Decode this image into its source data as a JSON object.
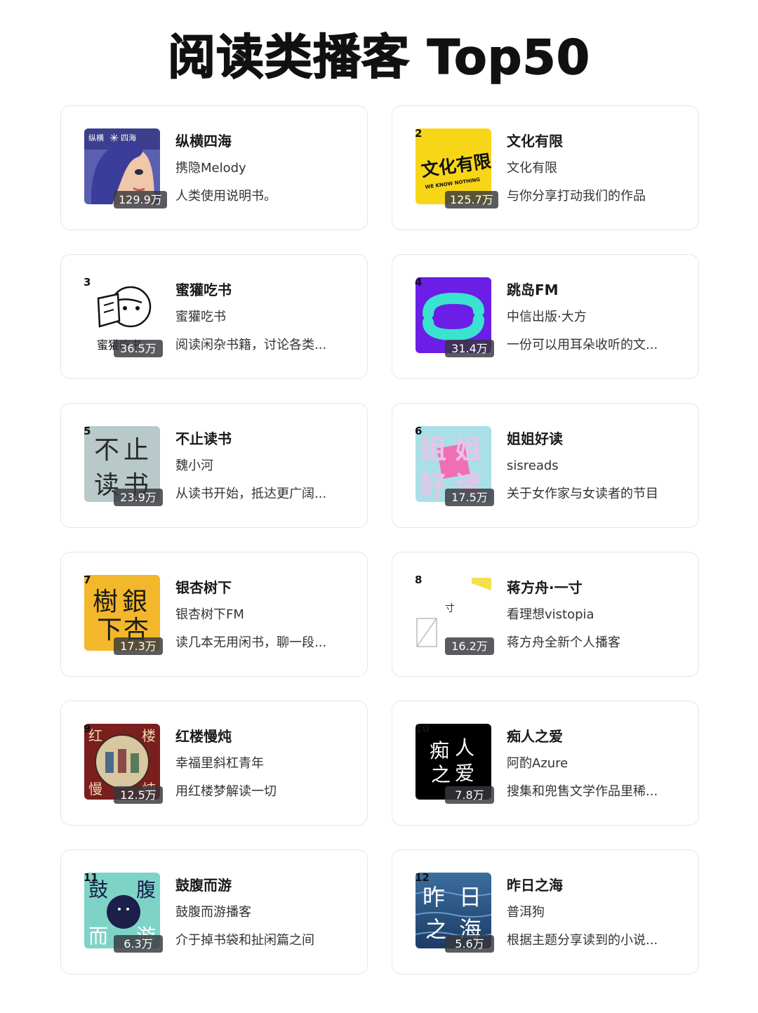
{
  "title": "阅读类播客 Top50",
  "podcasts": [
    {
      "rank": "",
      "name": "纵横四海",
      "author": "携隐Melody",
      "desc": "人类使用说明书。",
      "plays": "129.9万",
      "cover_text": [
        "纵横",
        "四海"
      ]
    },
    {
      "rank": "2",
      "name": "文化有限",
      "author": "文化有限",
      "desc": "与你分享打动我们的作品",
      "plays": "125.7万",
      "cover_text": [
        "文化有限",
        "WE KNOW NOTHING"
      ]
    },
    {
      "rank": "3",
      "name": "蜜獾吃书",
      "author": "蜜獾吃书",
      "desc": "阅读闲杂书籍，讨论各类...",
      "plays": "36.5万",
      "cover_text": [
        "蜜獾吃书"
      ]
    },
    {
      "rank": "4",
      "name": "跳岛FM",
      "author": "中信出版·大方",
      "desc": "一份可以用耳朵收听的文...",
      "plays": "31.4万",
      "cover_text": []
    },
    {
      "rank": "5",
      "name": "不止读书",
      "author": "魏小河",
      "desc": "从读书开始，抵达更广阔...",
      "plays": "23.9万",
      "cover_text": [
        "不",
        "止",
        "读",
        "书"
      ]
    },
    {
      "rank": "6",
      "name": "姐姐好读",
      "author": "sisreads",
      "desc": "关于女作家与女读者的节目",
      "plays": "17.5万",
      "cover_text": [
        "姐",
        "姐",
        "好",
        "读"
      ]
    },
    {
      "rank": "7",
      "name": "银杏树下",
      "author": "银杏树下FM",
      "desc": "读几本无用闲书，聊一段...",
      "plays": "17.3万",
      "cover_text": [
        "樹",
        "銀",
        "下",
        "杏"
      ]
    },
    {
      "rank": "8",
      "name": "蒋方舟·一寸",
      "author": "看理想vistopia",
      "desc": "蒋方舟全新个人播客",
      "plays": "16.2万",
      "cover_text": [
        "寸"
      ]
    },
    {
      "rank": "9",
      "name": "红楼慢炖",
      "author": "幸福里斜杠青年",
      "desc": "用红楼梦解读一切",
      "plays": "12.5万",
      "cover_text": [
        "红",
        "楼",
        "慢",
        "炖"
      ]
    },
    {
      "rank": "10",
      "name": "痴人之爱",
      "author": "阿酌Azure",
      "desc": "搜集和兜售文学作品里稀...",
      "plays": "7.8万",
      "cover_text": [
        "痴",
        "人",
        "之",
        "爱"
      ]
    },
    {
      "rank": "11",
      "name": "鼓腹而游",
      "author": "鼓腹而游播客",
      "desc": "介于掉书袋和扯闲篇之间",
      "plays": "6.3万",
      "cover_text": [
        "鼓",
        "腹",
        "而",
        "游"
      ]
    },
    {
      "rank": "12",
      "name": "昨日之海",
      "author": "普洱狗",
      "desc": "根据主题分享读到的小说...",
      "plays": "5.6万",
      "cover_text": [
        "昨",
        "日",
        "之",
        "海"
      ]
    }
  ]
}
